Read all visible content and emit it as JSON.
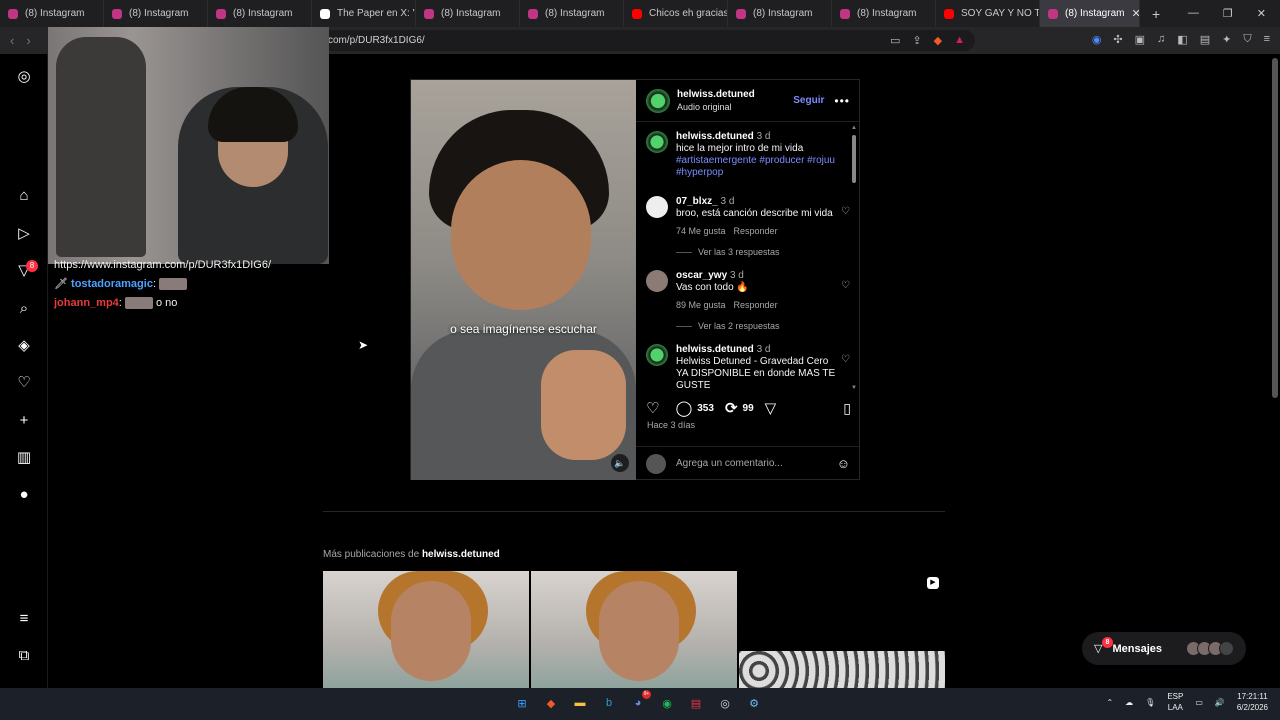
{
  "browser": {
    "tabs": [
      {
        "label": "(8) Instagram",
        "color": "#c13584"
      },
      {
        "label": "(8) Instagram",
        "color": "#c13584"
      },
      {
        "label": "(8) Instagram",
        "color": "#c13584"
      },
      {
        "label": "The Paper en X: \"htt",
        "color": "#ffffff"
      },
      {
        "label": "(8) Instagram",
        "color": "#c13584"
      },
      {
        "label": "(8) Instagram",
        "color": "#c13584"
      },
      {
        "label": "Chicos eh gracias a",
        "color": "#ff0000"
      },
      {
        "label": "(8) Instagram",
        "color": "#c13584"
      },
      {
        "label": "(8) Instagram",
        "color": "#c13584"
      },
      {
        "label": "SOY GAY Y NO TIEN",
        "color": "#ff0000"
      }
    ],
    "active_tab": "(8) Instagram",
    "url": "com/p/DUR3fx1DIG6/"
  },
  "nav": {
    "notifications_badge": "8"
  },
  "chat": {
    "line1": "https://www.instagram.com/p/DUR3fx1DIG6/",
    "user1": "tostadoramagic",
    "user2": "johann_mp4",
    "msg2": "o no"
  },
  "post": {
    "username": "helwiss.detuned",
    "audio": "Audio original",
    "follow": "Seguir",
    "caption_overlay": "o sea imagínense escuchar",
    "comments": [
      {
        "user": "helwiss.detuned",
        "time": "3 d",
        "text": "hice la mejor intro de mi vida",
        "tags": "#artistaemergente #producer #rojuu #hyperpop"
      },
      {
        "user": "07_blxz_",
        "time": "3 d",
        "text": "broo, está canción describe mi vida",
        "likes": "74 Me gusta",
        "reply": "Responder",
        "replies": "Ver las 3 respuestas"
      },
      {
        "user": "oscar_ywy",
        "time": "3 d",
        "text": "Vas con todo 🔥",
        "likes": "89 Me gusta",
        "reply": "Responder",
        "replies": "Ver las 2 respuestas"
      },
      {
        "user": "helwiss.detuned",
        "time": "3 d",
        "text": "Helwiss Detuned - Gravedad Cero YA DISPONIBLE en donde MAS TE GUSTE"
      }
    ],
    "comment_count": "353",
    "repost_count": "99",
    "posted_ago": "Hace 3 días",
    "add_comment_placeholder": "Agrega un comentario..."
  },
  "more_posts": {
    "prefix": "Más publicaciones de",
    "username": "helwiss.detuned"
  },
  "messages": {
    "label": "Mensajes",
    "badge": "8"
  },
  "taskbar": {
    "lang_top": "ESP",
    "lang_bottom": "LAA",
    "time": "17:21:11",
    "date": "6/2/2026",
    "discord_badge": "9+"
  }
}
